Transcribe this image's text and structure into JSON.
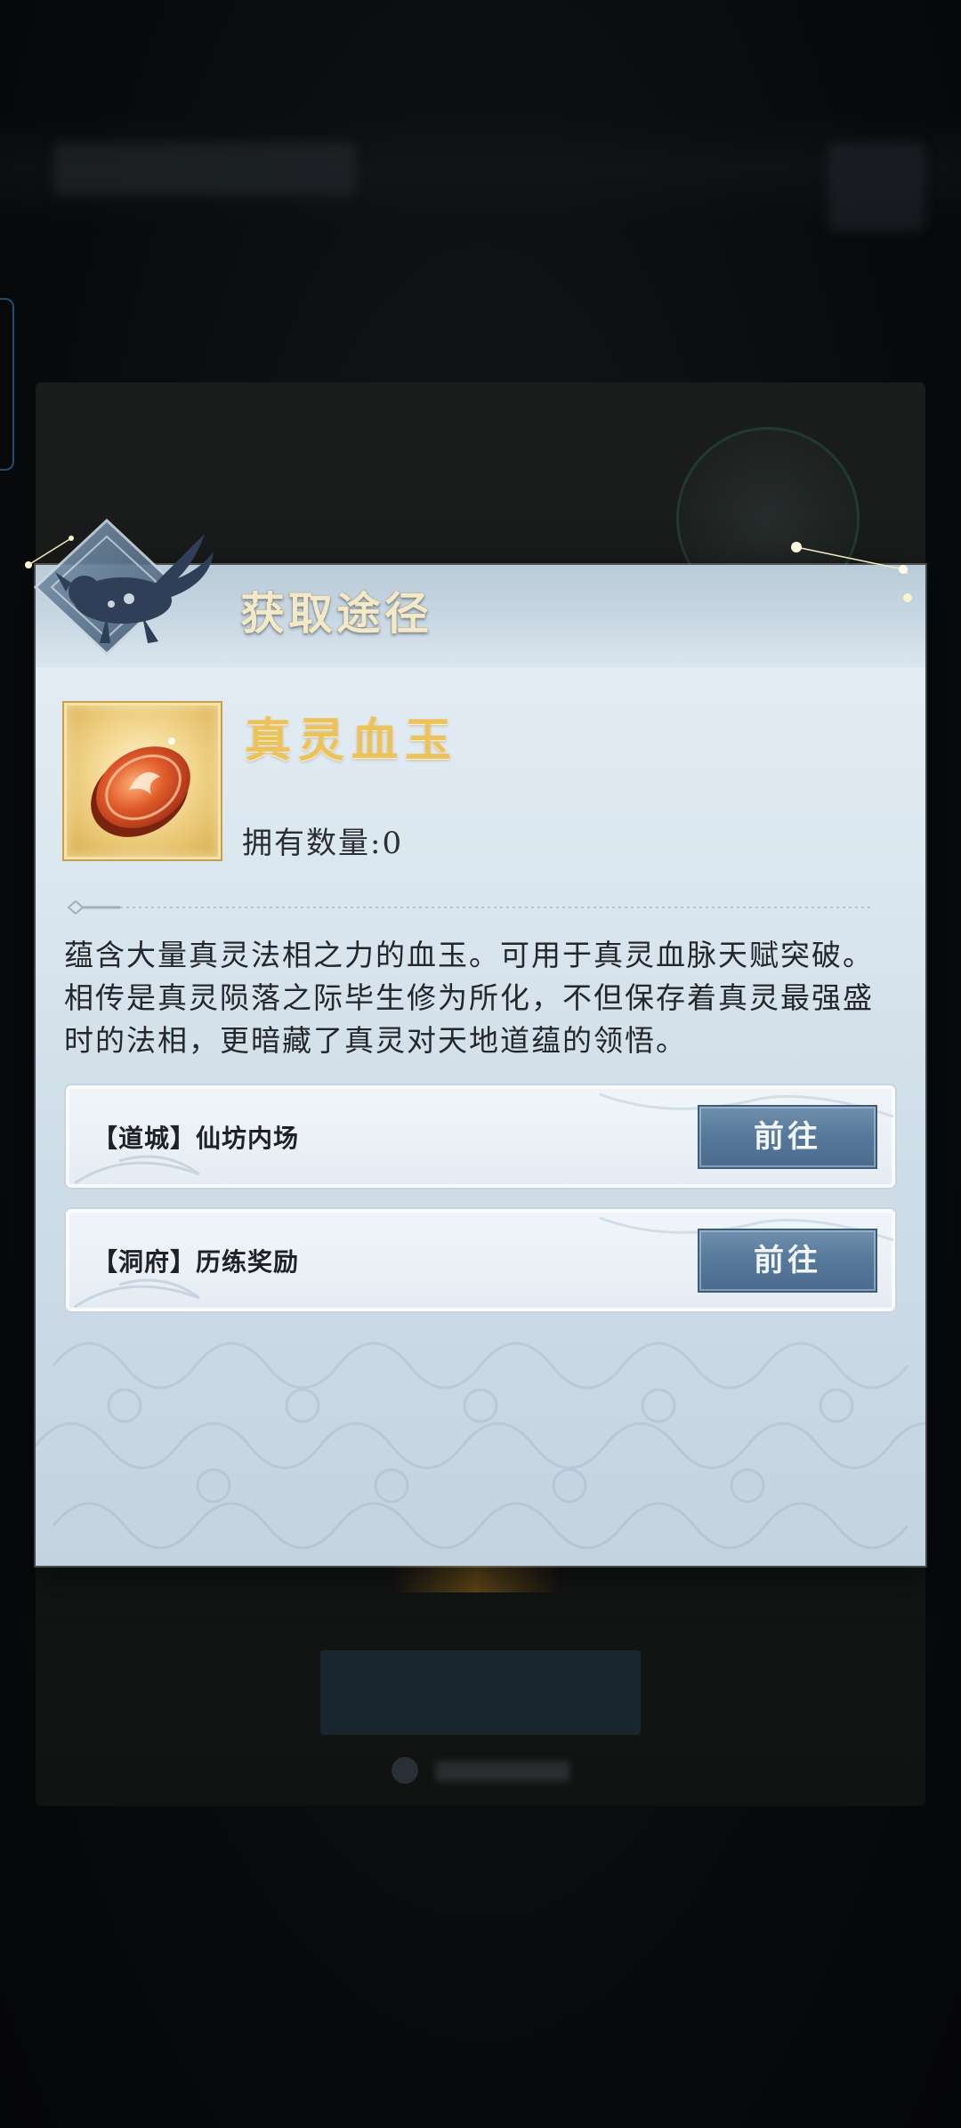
{
  "dialog": {
    "title": "获取途径"
  },
  "item": {
    "name": "真灵血玉",
    "owned_label": "拥有数量:",
    "owned_count": "0",
    "description": "蕴含大量真灵法相之力的血玉。可用于真灵血脉天赋突破。相传是真灵陨落之际毕生修为所化，不但保存着真灵最强盛时的法相，更暗藏了真灵对天地道蕴的领悟。"
  },
  "sources": [
    {
      "label": "【道城】仙坊内场",
      "button_label": "前往"
    },
    {
      "label": "【洞府】历练奖励",
      "button_label": "前往"
    }
  ],
  "colors": {
    "title_gold": "#f3e9c6",
    "item_name_gold": "#ecc35a",
    "button_blue": "#56789a",
    "panel_bg": "#dbe7f0"
  }
}
